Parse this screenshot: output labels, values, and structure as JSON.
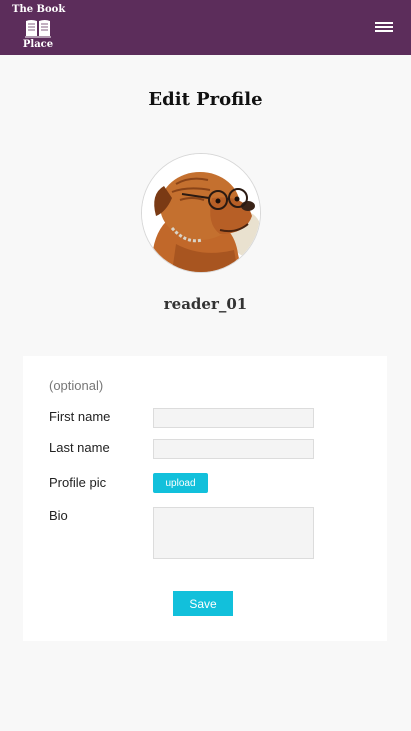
{
  "header": {
    "logo_line1": "The Book",
    "logo_line2": "Place",
    "logo_icon": "open-book-icon",
    "menu_icon": "hamburger-menu-icon",
    "background_color": "#5c2d5b"
  },
  "page": {
    "title": "Edit Profile",
    "avatar_description": "profile photo of a brown dog wearing glasses",
    "username": "reader_01"
  },
  "form": {
    "optional_note": "(optional)",
    "first_name": {
      "label": "First name",
      "value": ""
    },
    "last_name": {
      "label": "Last name",
      "value": ""
    },
    "profile_pic": {
      "label": "Profile pic",
      "button_label": "upload"
    },
    "bio": {
      "label": "Bio",
      "value": ""
    },
    "save_label": "Save",
    "accent_color": "#12c0db"
  }
}
